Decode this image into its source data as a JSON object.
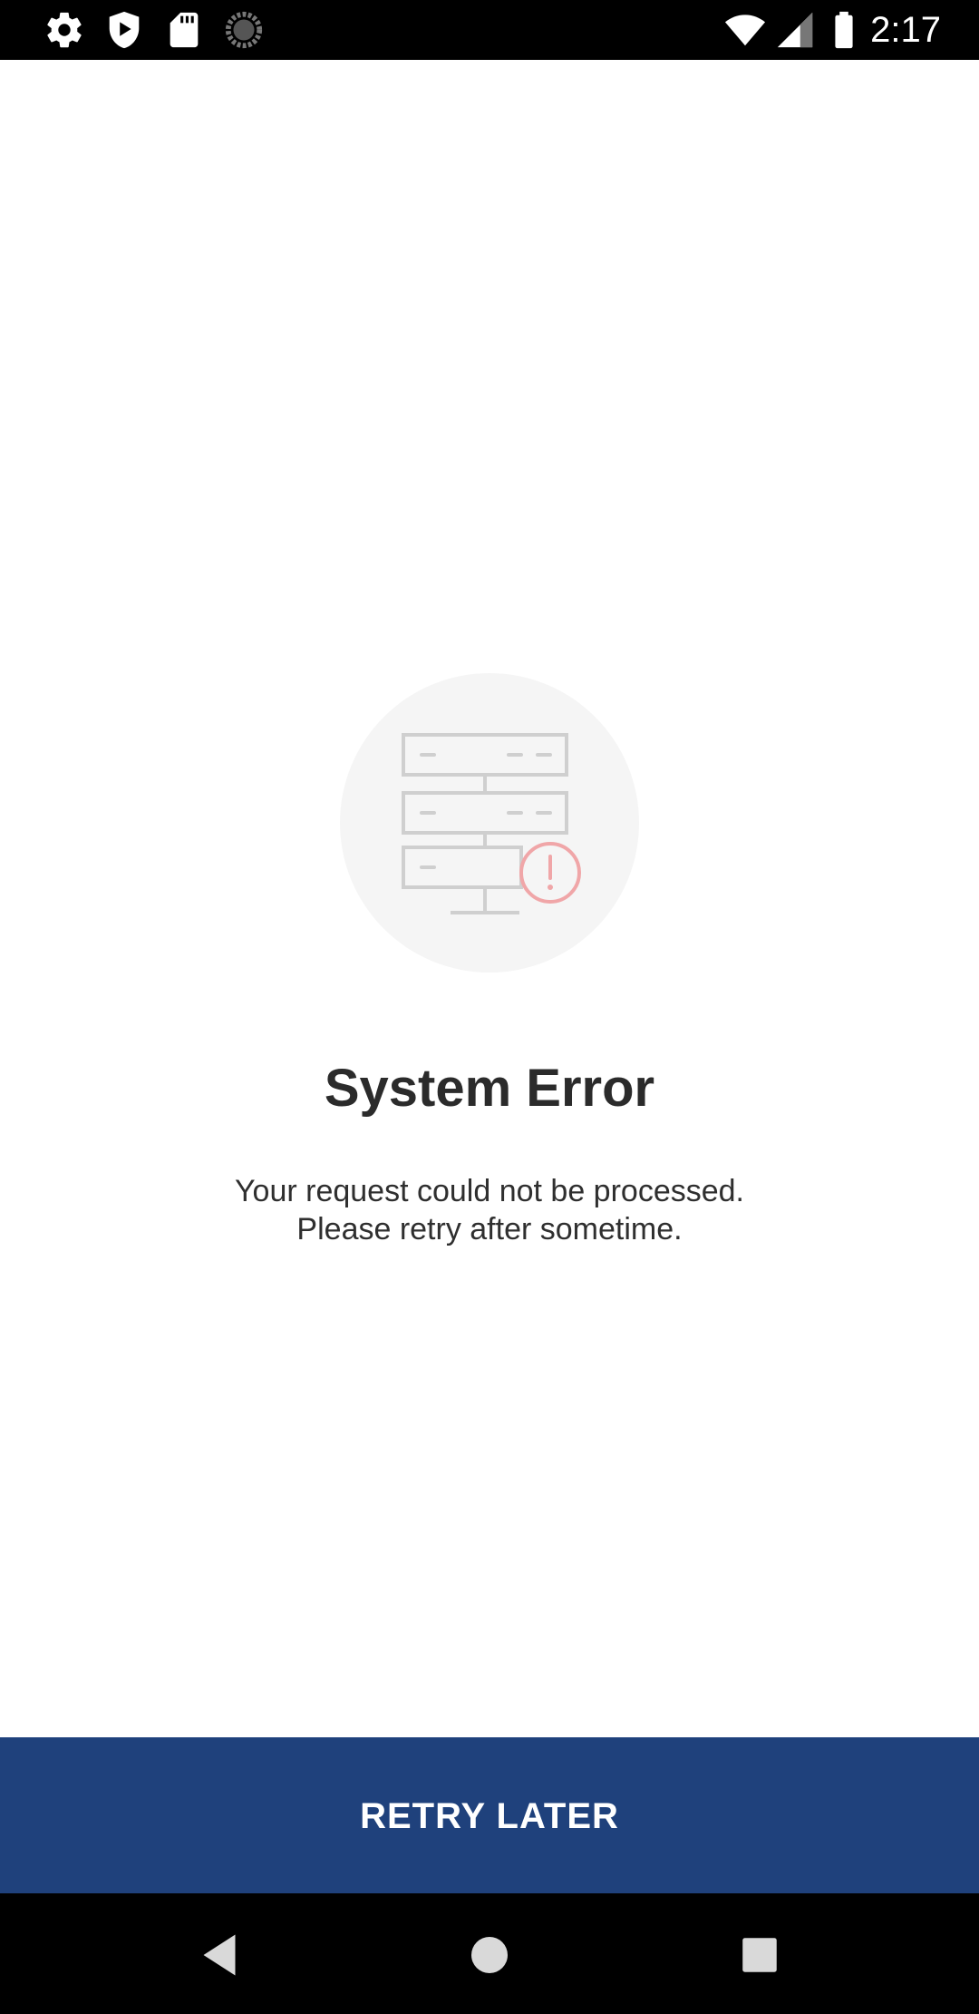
{
  "status_bar": {
    "time": "2:17",
    "left_icons": [
      "settings-icon",
      "shield-play-icon",
      "sd-card-icon",
      "sync-icon"
    ],
    "right_icons": [
      "wifi-icon",
      "cell-signal-icon",
      "battery-icon"
    ]
  },
  "error": {
    "illustration": "server-error-icon",
    "title": "System Error",
    "message_line1": "Your request could not be processed.",
    "message_line2": "Please retry after sometime."
  },
  "action": {
    "button_label": "RETRY LATER"
  },
  "nav_bar": {
    "buttons": [
      "back-icon",
      "home-icon",
      "recents-icon"
    ]
  },
  "colors": {
    "primary": "#1f417c",
    "alert": "#f0a6a8",
    "illustration_stroke": "#cfcfcf",
    "illustration_bg": "#f5f5f5"
  }
}
